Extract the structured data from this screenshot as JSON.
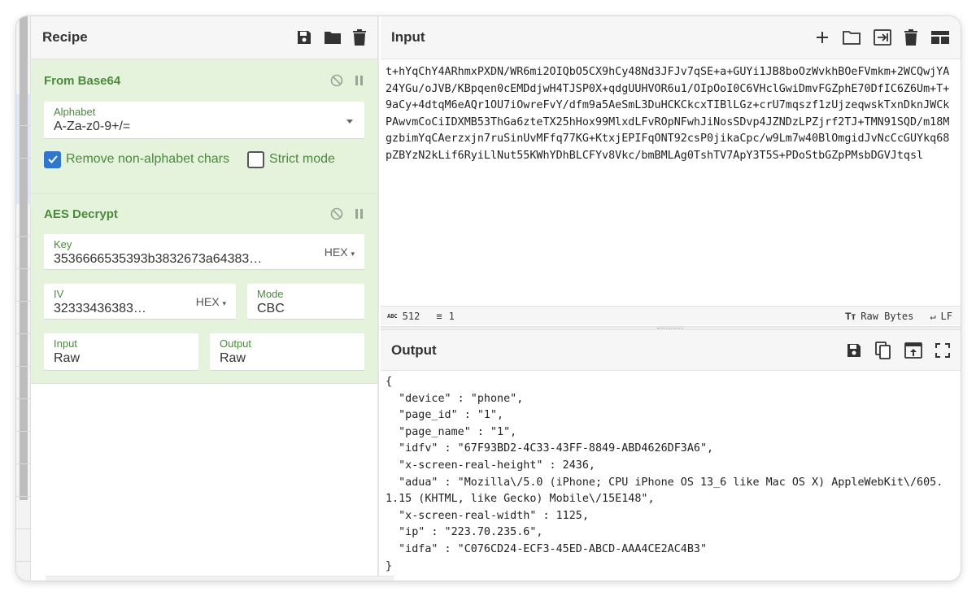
{
  "recipe": {
    "title": "Recipe",
    "operations": {
      "from_base64": {
        "title": "From Base64",
        "alphabet_label": "Alphabet",
        "alphabet_value": "A-Za-z0-9+/=",
        "remove_non_alphabet_label": "Remove non-alphabet chars",
        "remove_non_alphabet_checked": true,
        "strict_mode_label": "Strict mode",
        "strict_mode_checked": false
      },
      "aes_decrypt": {
        "title": "AES Decrypt",
        "key_label": "Key",
        "key_value": "3536666535393b3832673a64383…",
        "key_format": "HEX",
        "iv_label": "IV",
        "iv_value": "32333436383…",
        "iv_format": "HEX",
        "mode_label": "Mode",
        "mode_value": "CBC",
        "input_label": "Input",
        "input_value": "Raw",
        "output_label": "Output",
        "output_value": "Raw"
      }
    }
  },
  "input": {
    "title": "Input",
    "text": "t+hYqChY4ARhmxPXDN/WR6mi2OIQbO5CX9hCy48Nd3JFJv7qSE+a+GUYi1JB8boOzWvkhBOeFVmkm+2WCQwjYA24YGu/oJVB/KBpqen0cEMDdjwH4TJSP0X+qdgUUHVOR6u1/OIpOoI0C6VHclGwiDmvFGZphE70DfIC6Z6Um+T+9aCy+4dtqM6eAQr1OU7iOwreFvY/dfm9a5AeSmL3DuHCKCkcxTIBlLGz+crU7mqszf1zUjzeqwskTxnDknJWCkPAwvmCoCiIDXMB53ThGa6zteTX25hHox99MlxdLFvROpNFwhJiNosSDvp4JZNDzLPZjrf2TJ+TMN91SQD/m18MgzbimYqCAerzxjn7ruSinUvMFfq77KG+KtxjEPIFqONT92csP0jikaCpc/w9Lm7w40BlOmgidJvNcCcGUYkq68pZBYzN2kLif6RyiLlNut55KWhYDhBLCFYv8Vkc/bmBMLAg0TshTV7ApY3T5S+PDoStbGZpPMsbDGVJtqsl",
    "status": {
      "length": "512",
      "lines": "1",
      "encoding": "Raw Bytes",
      "eol": "LF"
    }
  },
  "output": {
    "title": "Output",
    "text": "{\n  \"device\" : \"phone\",\n  \"page_id\" : \"1\",\n  \"page_name\" : \"1\",\n  \"idfv\" : \"67F93BD2-4C33-43FF-8849-ABD4626DF3A6\",\n  \"x-screen-real-height\" : 2436,\n  \"adua\" : \"Mozilla\\/5.0 (iPhone; CPU iPhone OS 13_6 like Mac OS X) AppleWebKit\\/605.1.15 (KHTML, like Gecko) Mobile\\/15E148\",\n  \"x-screen-real-width\" : 1125,\n  \"ip\" : \"223.70.235.6\",\n  \"idfa\" : \"C076CD24-ECF3-45ED-ABCD-AAA4CE2AC4B3\"\n}"
  },
  "colors": {
    "op_background": "#e5f3dd",
    "op_title": "#4b8a3c",
    "checkbox_on": "#2f76cf"
  }
}
